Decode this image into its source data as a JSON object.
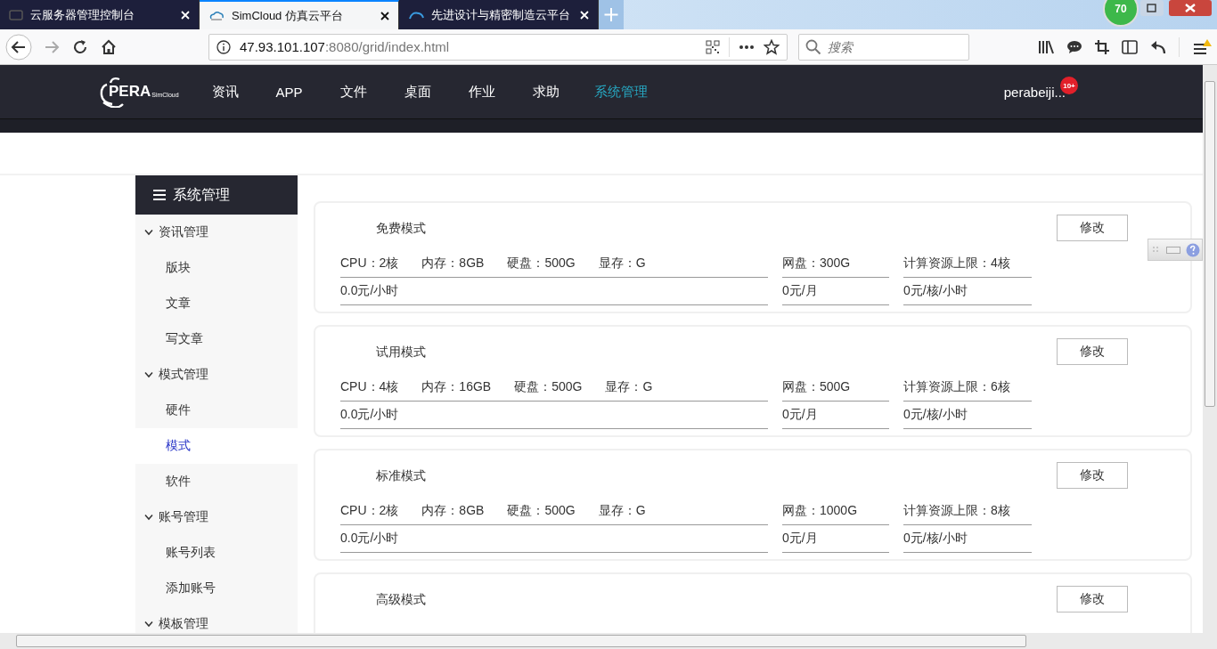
{
  "browser": {
    "tabs": [
      {
        "title": "云服务器管理控制台",
        "selected": false,
        "kind": "console"
      },
      {
        "title": "SimCloud 仿真云平台",
        "selected": true,
        "kind": "pera"
      },
      {
        "title": "先进设计与精密制造云平台",
        "selected": false,
        "kind": "cloud"
      }
    ],
    "address": {
      "host": "47.93.101.107",
      "rest": ":8080/grid/index.html"
    },
    "search": {
      "placeholder": "搜索"
    },
    "speed_badge": "70"
  },
  "nav": {
    "logo": {
      "main": "PERA",
      "sub": "SimCloud"
    },
    "items": [
      {
        "label": "资讯",
        "selected": false
      },
      {
        "label": "APP",
        "selected": false
      },
      {
        "label": "文件",
        "selected": false
      },
      {
        "label": "桌面",
        "selected": false
      },
      {
        "label": "作业",
        "selected": false
      },
      {
        "label": "求助",
        "selected": false
      },
      {
        "label": "系统管理",
        "selected": true
      }
    ],
    "user": "perabeiji...",
    "badge": "10+"
  },
  "sidebar": {
    "title": "系统管理",
    "groups": [
      {
        "label": "资讯管理",
        "expanded": true,
        "children": [
          {
            "label": "版块",
            "selected": false
          },
          {
            "label": "文章",
            "selected": false
          },
          {
            "label": "写文章",
            "selected": false
          }
        ]
      },
      {
        "label": "模式管理",
        "expanded": true,
        "children": [
          {
            "label": "硬件",
            "selected": false
          },
          {
            "label": "模式",
            "selected": true
          },
          {
            "label": "软件",
            "selected": false
          }
        ]
      },
      {
        "label": "账号管理",
        "expanded": true,
        "children": [
          {
            "label": "账号列表",
            "selected": false
          },
          {
            "label": "添加账号",
            "selected": false
          }
        ]
      },
      {
        "label": "模板管理",
        "expanded": true
      }
    ]
  },
  "cards": [
    {
      "title": "免费模式",
      "button": "修改",
      "specs": [
        "CPU：2核",
        "内存：8GB",
        "硬盘：500G",
        "显存：G"
      ],
      "netdisk": "网盘：300G",
      "compute_limit": "计算资源上限：4核",
      "price_hour": "0.0元/小时",
      "price_month": "0元/月",
      "price_core": "0元/核/小时"
    },
    {
      "title": "试用模式",
      "button": "修改",
      "specs": [
        "CPU：4核",
        "内存：16GB",
        "硬盘：500G",
        "显存：G"
      ],
      "netdisk": "网盘：500G",
      "compute_limit": "计算资源上限：6核",
      "price_hour": "0.0元/小时",
      "price_month": "0元/月",
      "price_core": "0元/核/小时"
    },
    {
      "title": "标准模式",
      "button": "修改",
      "specs": [
        "CPU：2核",
        "内存：8GB",
        "硬盘：500G",
        "显存：G"
      ],
      "netdisk": "网盘：1000G",
      "compute_limit": "计算资源上限：8核",
      "price_hour": "0.0元/小时",
      "price_month": "0元/月",
      "price_core": "0元/核/小时"
    },
    {
      "title": "高级模式",
      "button": "修改"
    }
  ]
}
